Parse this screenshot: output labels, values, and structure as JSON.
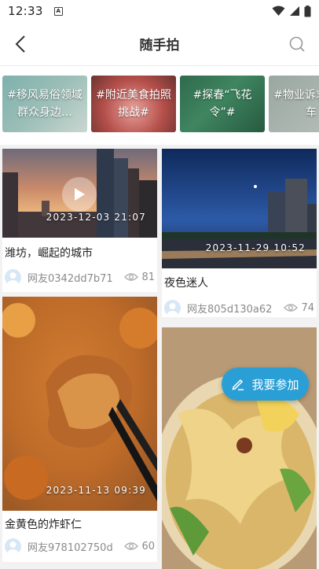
{
  "status_bar": {
    "time": "12:33",
    "notification_icon": "A"
  },
  "header": {
    "title": "随手拍"
  },
  "topics": [
    {
      "label": "#移风易俗领域群众身边…"
    },
    {
      "label": "#附近美食拍照挑战#"
    },
    {
      "label": "#探春“飞花令”#"
    },
    {
      "label": "#物业诉求直通车"
    }
  ],
  "posts": [
    {
      "timestamp": "2023-12-03  21:07",
      "title": "潍坊，崛起的城市",
      "author": "网友0342dd7b71",
      "views": "81",
      "is_video": true
    },
    {
      "timestamp": "2023-11-29  10:52",
      "title": "夜色迷人",
      "author": "网友805d130a62",
      "views": "74"
    },
    {
      "timestamp": "2023-11-13  09:39",
      "title": "金黄色的炸虾仁",
      "author": "网友978102750d",
      "views": "60"
    },
    {
      "timestamp": "",
      "title": "",
      "author": "",
      "views": ""
    }
  ],
  "fab": {
    "label": "我要参加"
  },
  "colors": {
    "accent": "#2a9fd6"
  }
}
